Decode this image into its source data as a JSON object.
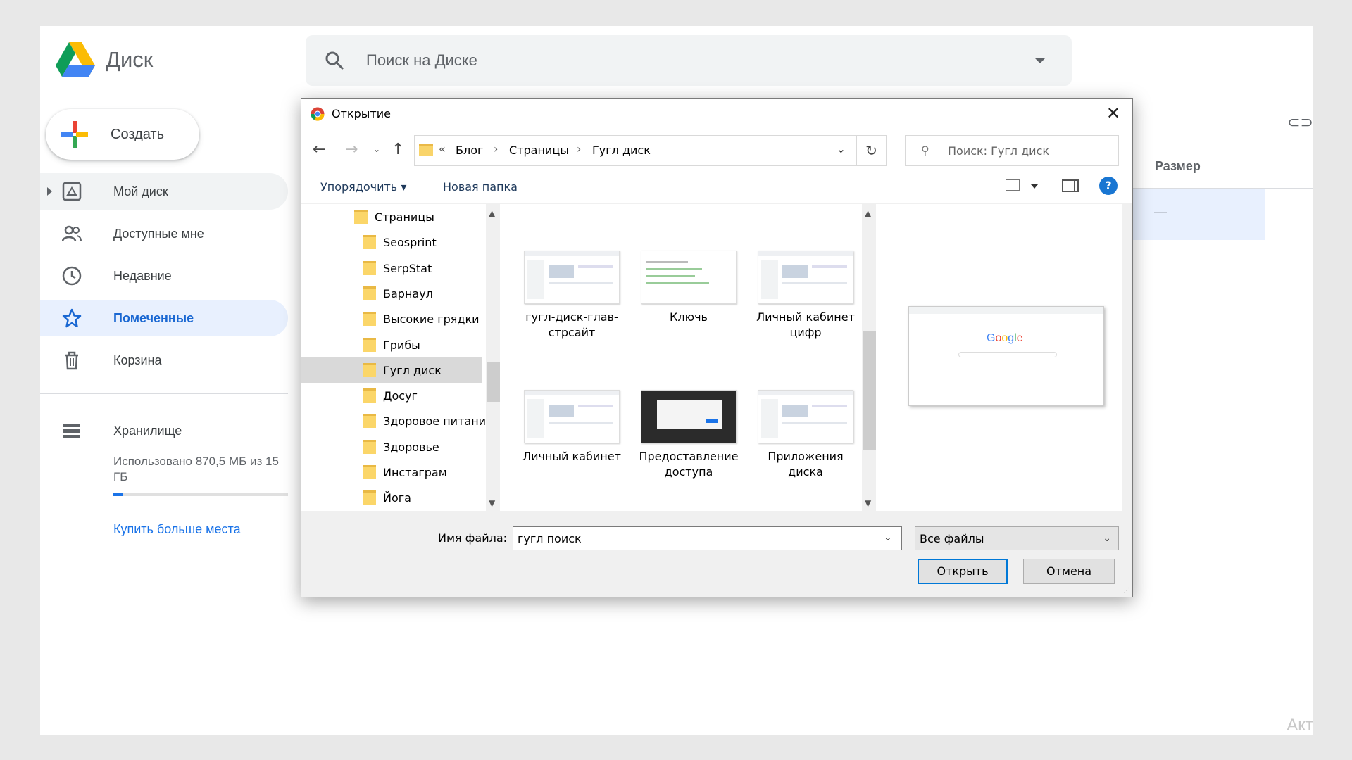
{
  "drive": {
    "app_name": "Диск",
    "search_placeholder": "Поиск на Диске",
    "create_label": "Создать",
    "nav": [
      {
        "label": "Мой диск",
        "icon": "drive-icon"
      },
      {
        "label": "Доступные мне",
        "icon": "people-icon"
      },
      {
        "label": "Недавние",
        "icon": "clock-icon"
      },
      {
        "label": "Помеченные",
        "icon": "star-icon",
        "active": true
      },
      {
        "label": "Корзина",
        "icon": "trash-icon"
      }
    ],
    "storage_label": "Хранилище",
    "storage_used_text": "Использовано 870,5 МБ из 15 ГБ",
    "storage_fraction": 0.057,
    "buy_storage_label": "Купить больше места",
    "column_size_header": "Размер",
    "row_size_value": "—",
    "watermark": "Акт",
    "colors": {
      "accent": "#1a73e8",
      "active_bg": "#e8f0fe"
    }
  },
  "dialog": {
    "title": "Открытие",
    "breadcrumb": {
      "prefix": "«",
      "items": [
        "Блог",
        "Страницы",
        "Гугл диск"
      ]
    },
    "search_placeholder": "Поиск: Гугл диск",
    "organize_label": "Упорядочить",
    "new_folder_label": "Новая папка",
    "help_label": "?",
    "tree": [
      {
        "label": "Страницы",
        "level": 0
      },
      {
        "label": "Seosprint",
        "level": 1
      },
      {
        "label": "SerpStat",
        "level": 1
      },
      {
        "label": "Барнаул",
        "level": 1
      },
      {
        "label": "Высокие грядки",
        "level": 1
      },
      {
        "label": "Грибы",
        "level": 1
      },
      {
        "label": "Гугл диск",
        "level": 1,
        "selected": true
      },
      {
        "label": "Досуг",
        "level": 1
      },
      {
        "label": "Здоровое питани",
        "level": 1
      },
      {
        "label": "Здоровье",
        "level": 1
      },
      {
        "label": "Инстаграм",
        "level": 1
      },
      {
        "label": "Йога",
        "level": 1
      }
    ],
    "files": [
      {
        "name": "гугл-диск-глав-стрсайт",
        "thumb": "light"
      },
      {
        "name": "Ключь",
        "thumb": "text"
      },
      {
        "name": "Личный кабинет цифр",
        "thumb": "light"
      },
      {
        "name": "Личный кабинет",
        "thumb": "light"
      },
      {
        "name": "Предоставление доступа",
        "thumb": "dark"
      },
      {
        "name": "Приложения диска",
        "thumb": "light"
      }
    ],
    "preview_logo": "Google",
    "filename_label": "Имя файла:",
    "filename_value": "гугл поиск",
    "filetype_value": "Все файлы",
    "open_label": "Открыть",
    "cancel_label": "Отмена"
  }
}
